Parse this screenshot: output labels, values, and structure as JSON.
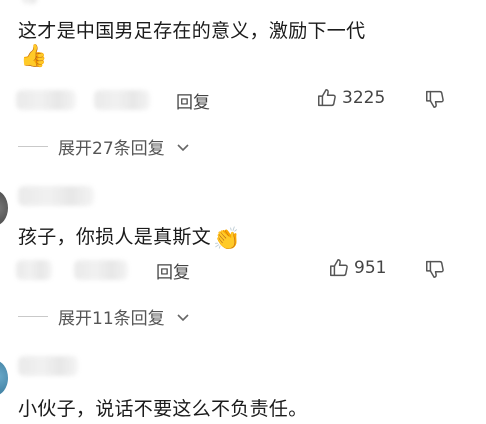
{
  "comments": [
    {
      "text": "这才是中国男足存在的意义，激励下一代",
      "emoji": "👍",
      "reply_label": "回复",
      "like_count": "3225",
      "expand_label": "展开27条回复"
    },
    {
      "text": "孩子，你损人是真斯文",
      "emoji": "👏",
      "reply_label": "回复",
      "like_count": "951",
      "expand_label": "展开11条回复"
    },
    {
      "text": "小伙子，说话不要这么不负责任。"
    }
  ],
  "icons": {
    "like": "thumbs-up-outline-icon",
    "dislike": "thumbs-down-outline-icon",
    "expand": "chevron-down-icon"
  }
}
